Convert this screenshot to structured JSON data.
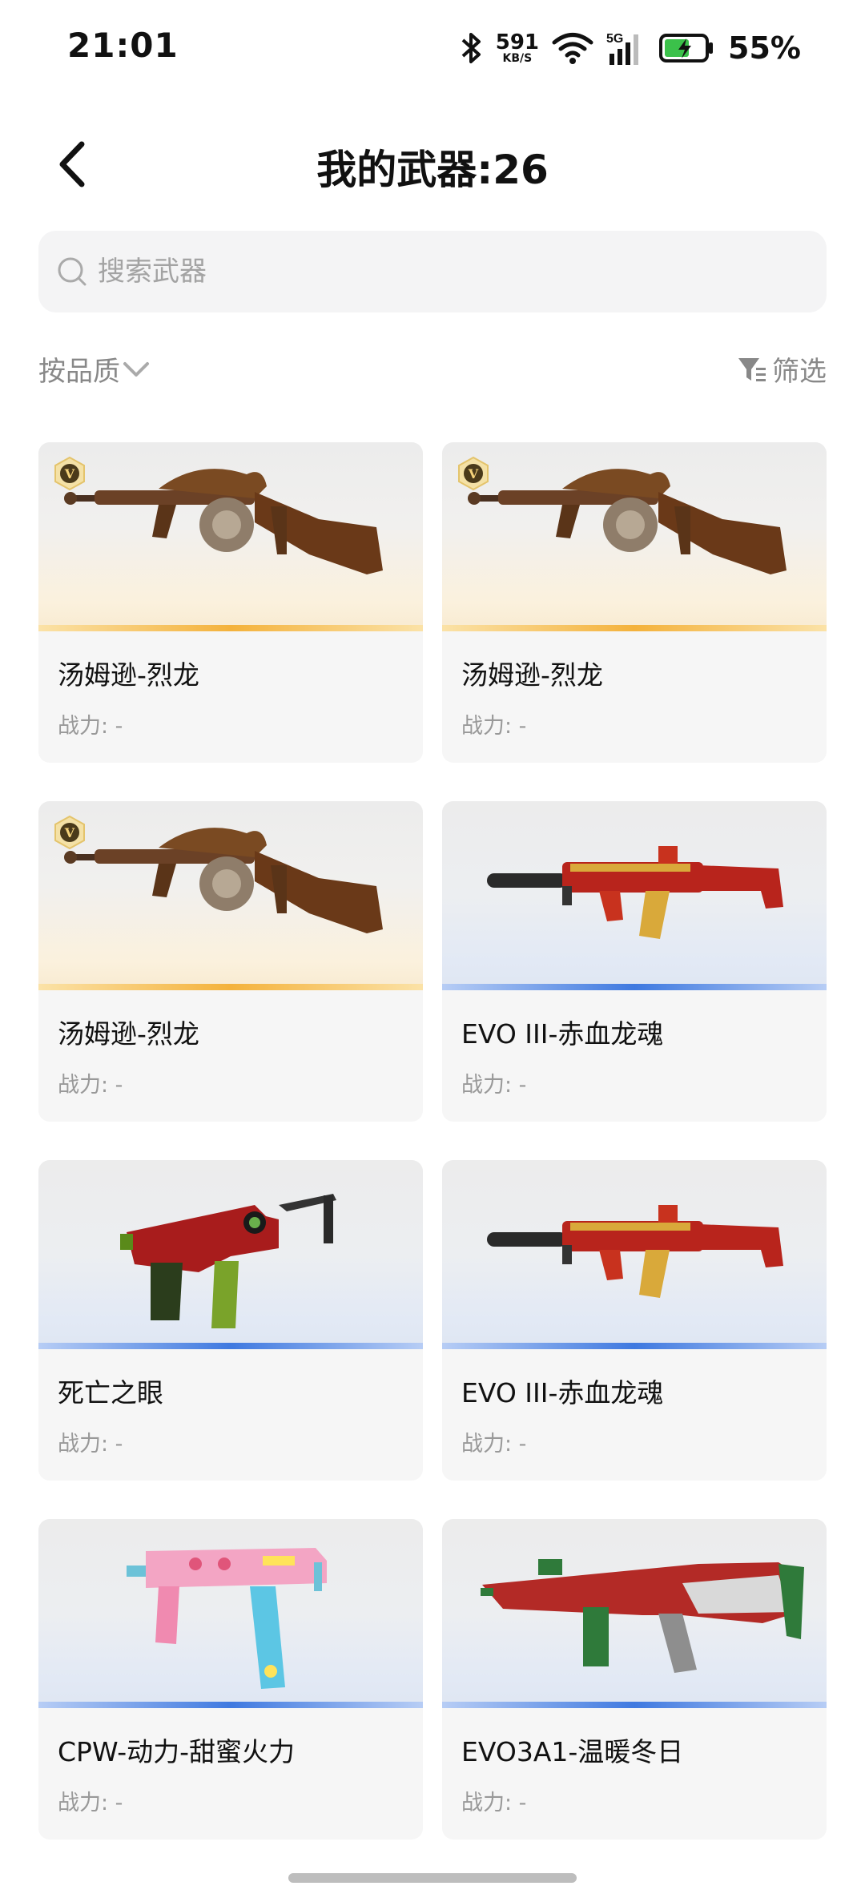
{
  "status": {
    "time": "21:01",
    "speed_value": "591",
    "speed_unit": "KB/S",
    "network_label": "5G",
    "battery_percent": "55%"
  },
  "header": {
    "title": "我的武器:26"
  },
  "search": {
    "placeholder": "搜索武器"
  },
  "filters": {
    "sort_label": "按品质",
    "filter_label": "筛选"
  },
  "weapons": [
    {
      "name": "汤姆逊-烈龙",
      "power": "战力: -",
      "quality": "gold",
      "badge": "V"
    },
    {
      "name": "汤姆逊-烈龙",
      "power": "战力: -",
      "quality": "gold",
      "badge": "V"
    },
    {
      "name": "汤姆逊-烈龙",
      "power": "战力: -",
      "quality": "gold",
      "badge": "V"
    },
    {
      "name": "EVO III-赤血龙魂",
      "power": "战力: -",
      "quality": "blue"
    },
    {
      "name": "死亡之眼",
      "power": "战力: -",
      "quality": "blue"
    },
    {
      "name": "EVO III-赤血龙魂",
      "power": "战力: -",
      "quality": "blue"
    },
    {
      "name": "CPW-动力-甜蜜火力",
      "power": "战力: -",
      "quality": "blue"
    },
    {
      "name": "EVO3A1-温暖冬日",
      "power": "战力: -",
      "quality": "blue"
    }
  ],
  "colors": {
    "gold_accent": "#f4b23c",
    "blue_accent": "#3f79e0",
    "card_bg": "#f6f6f6"
  }
}
